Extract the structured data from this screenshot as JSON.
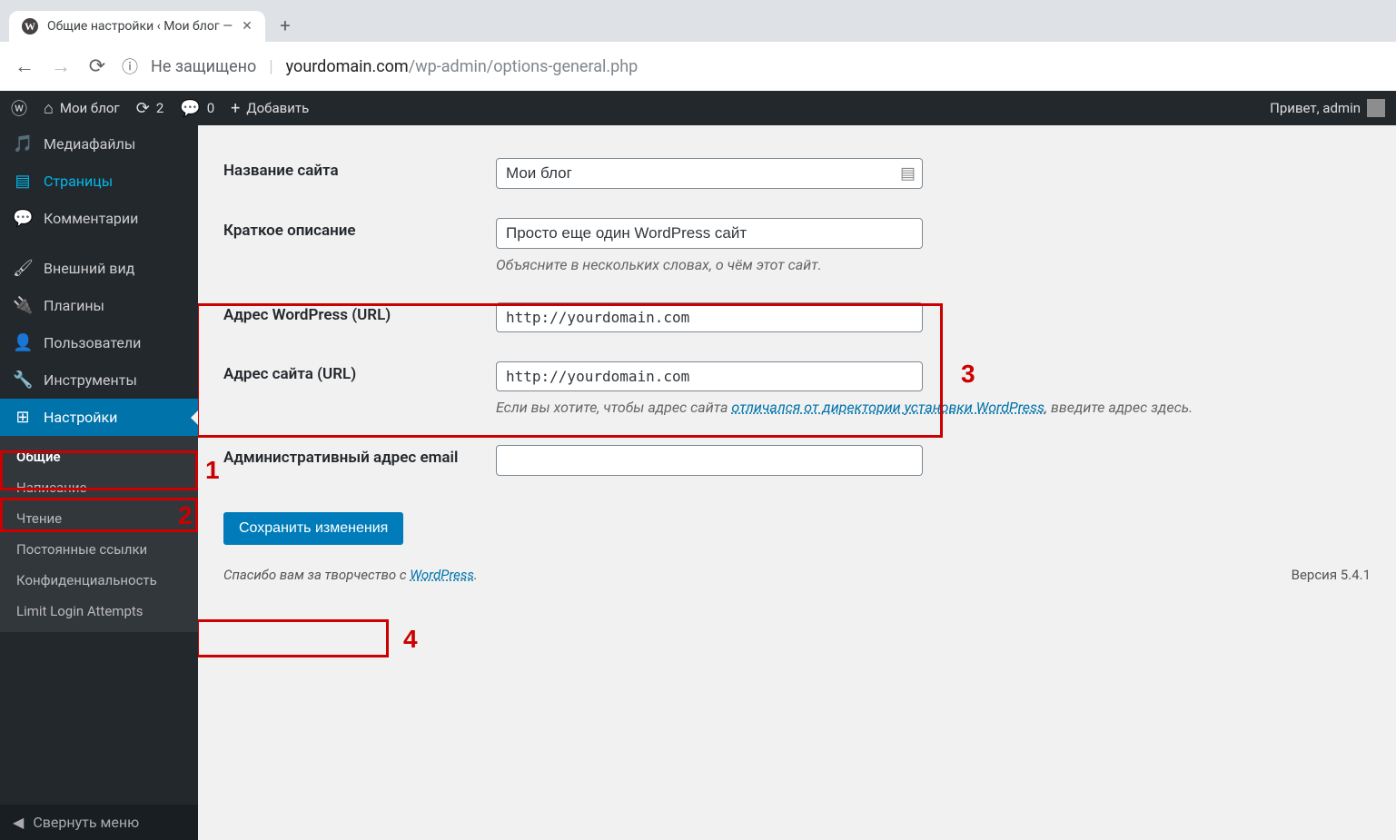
{
  "browser": {
    "tab_title": "Общие настройки ‹ Мои блог —",
    "security_label": "Не защищено",
    "url_domain": "yourdomain.com",
    "url_path": "/wp-admin/options-general.php"
  },
  "adminbar": {
    "site_name": "Мои блог",
    "updates_count": "2",
    "comments_count": "0",
    "add_new": "Добавить",
    "howdy": "Привет, admin"
  },
  "sidebar": {
    "media": "Медиафайлы",
    "pages": "Страницы",
    "comments": "Комментарии",
    "appearance": "Внешний вид",
    "plugins": "Плагины",
    "users": "Пользователи",
    "tools": "Инструменты",
    "settings": "Настройки",
    "submenu": {
      "general": "Общие",
      "writing": "Написание",
      "reading": "Чтение",
      "permalinks": "Постоянные ссылки",
      "privacy": "Конфиденциальность",
      "limit_login": "Limit Login Attempts"
    },
    "collapse": "Свернуть меню"
  },
  "form": {
    "site_title_label": "Название сайта",
    "site_title_value": "Мои блог",
    "tagline_label": "Краткое описание",
    "tagline_value": "Просто еще один WordPress сайт",
    "tagline_desc": "Объясните в нескольких словах, о чём этот сайт.",
    "wpurl_label": "Адрес WordPress (URL)",
    "wpurl_value": "http://yourdomain.com",
    "siteurl_label": "Адрес сайта (URL)",
    "siteurl_value": "http://yourdomain.com",
    "siteurl_desc_pre": "Если вы хотите, чтобы адрес сайта ",
    "siteurl_desc_link": "отличался от директории установки WordPress",
    "siteurl_desc_post": ", введите адрес здесь.",
    "admin_email_label": "Административный адрес email",
    "admin_email_value": "",
    "save_button": "Сохранить изменения"
  },
  "footer": {
    "thank_pre": "Спасибо вам за творчество с ",
    "thank_link": "WordPress",
    "thank_post": ".",
    "version": "Версия 5.4.1"
  },
  "annotations": {
    "n1": "1",
    "n2": "2",
    "n3": "3",
    "n4": "4"
  }
}
